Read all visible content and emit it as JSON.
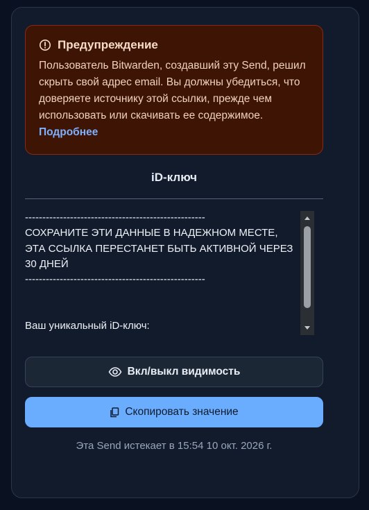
{
  "warning": {
    "title": "Предупреждение",
    "body": "Пользователь Bitwarden, создавший эту Send, решил скрыть свой адрес email. Вы должны убедиться, что доверяете источнику этой ссылки, прежде чем использовать или скачивать ее содержимое.",
    "link": "Подробнее"
  },
  "field": {
    "title": "iD-ключ",
    "content": "----------------------------------------------------\nСОХРАНИТЕ ЭТИ ДАННЫЕ В НАДЕЖНОМ МЕСТЕ, ЭТА ССЫЛКА ПЕРЕСТАНЕТ БЫТЬ АКТИВНОЙ ЧЕРЕЗ 30 ДНЕЙ\n----------------------------------------------------\n\n\nВаш уникальный iD-ключ:"
  },
  "buttons": {
    "toggle_visibility": "Вкл/выкл видимость",
    "copy_value": "Скопировать значение"
  },
  "expiry": "Эта Send истекает в 15:54 10 окт. 2026 г.",
  "icons": {
    "warning": "alert-circle-icon",
    "visibility": "eye-icon",
    "copy": "copy-icon"
  },
  "colors": {
    "accent": "#6aadff",
    "warning_bg": "#3e1404",
    "link": "#7db0ff"
  }
}
